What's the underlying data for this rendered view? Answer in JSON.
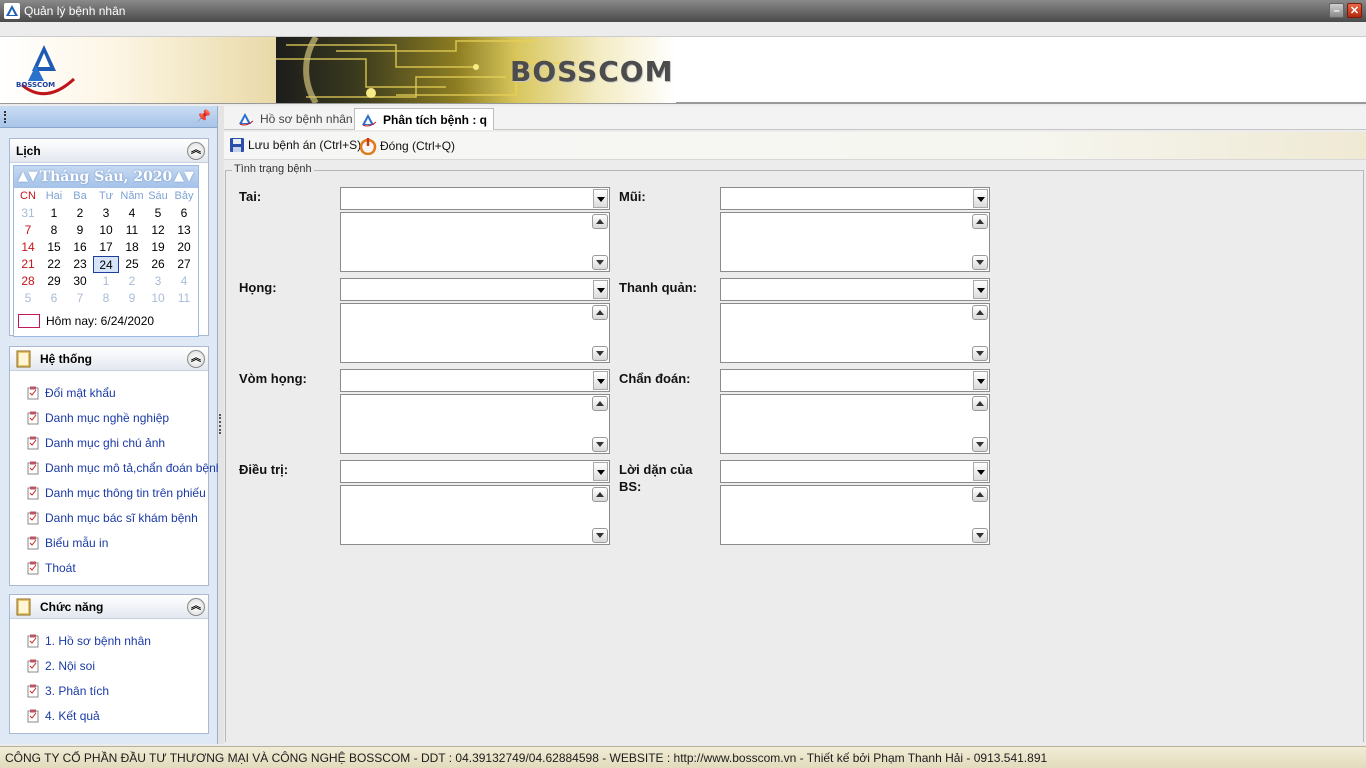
{
  "window": {
    "title": "Quản lý bệnh nhân"
  },
  "banner": {
    "brand": "BOSSCOM",
    "logo_text": "BOSSCOM"
  },
  "calendar": {
    "group_title": "Lịch",
    "month_title": "Tháng Sáu, 2020",
    "day_names": [
      "CN",
      "Hai",
      "Ba",
      "Tư",
      "Năm",
      "Sáu",
      "Bảy"
    ],
    "weeks": [
      [
        "31",
        "1",
        "2",
        "3",
        "4",
        "5",
        "6"
      ],
      [
        "7",
        "8",
        "9",
        "10",
        "11",
        "12",
        "13"
      ],
      [
        "14",
        "15",
        "16",
        "17",
        "18",
        "19",
        "20"
      ],
      [
        "21",
        "22",
        "23",
        "24",
        "25",
        "26",
        "27"
      ],
      [
        "28",
        "29",
        "30",
        "1",
        "2",
        "3",
        "4"
      ],
      [
        "5",
        "6",
        "7",
        "8",
        "9",
        "10",
        "11"
      ]
    ],
    "today_label": "Hôm nay: 6/24/2020"
  },
  "he_thong": {
    "title": "Hệ thống",
    "items": [
      "Đổi mật khẩu",
      "Danh mục nghề nghiệp",
      "Danh mục ghi chú ảnh",
      "Danh mục mô tả,chẩn đoán bệnh",
      "Danh mục thông tin trên phiếu",
      "Danh mục bác sĩ  khám bệnh",
      "Biểu mẫu in",
      "Thoát"
    ]
  },
  "chuc_nang": {
    "title": "Chức năng",
    "items": [
      "1. Hồ sơ bệnh nhân",
      "2. Nội soi",
      "3. Phân tích",
      "4. Kết quả"
    ]
  },
  "tabs": [
    {
      "label": "Hồ sơ bệnh nhân",
      "active": false
    },
    {
      "label": "Phân tích bệnh : q",
      "active": true
    }
  ],
  "toolbar": {
    "save_label": "Lưu bệnh án (Ctrl+S)",
    "close_label": "Đóng (Ctrl+Q)"
  },
  "form": {
    "legend": "Tình trạng bệnh",
    "fields": [
      {
        "label": "Tai:",
        "value": "",
        "note": ""
      },
      {
        "label": "Mũi:",
        "value": "",
        "note": ""
      },
      {
        "label": "Họng:",
        "value": "",
        "note": ""
      },
      {
        "label": "Thanh quản:",
        "value": "",
        "note": ""
      },
      {
        "label": "Vòm họng:",
        "value": "",
        "note": ""
      },
      {
        "label": "Chẩn đoán:",
        "value": "",
        "note": ""
      },
      {
        "label": "Điều trị:",
        "value": "",
        "note": ""
      },
      {
        "label": "Lời dặn của BS:",
        "value": "",
        "note": ""
      }
    ]
  },
  "statusbar": {
    "text": "CÔNG TY CỔ PHẦN ĐẦU TƯ THƯƠNG MẠI VÀ CÔNG NGHỆ BOSSCOM - DDT : 04.39132749/04.62884598 - WEBSITE : http://www.bosscom.vn - Thiết kế bởi Phạm Thanh Hải - 0913.541.891"
  },
  "colors": {
    "link": "#1a3aa6",
    "sunday": "#c8141b",
    "accent": "#a8c4e8"
  }
}
